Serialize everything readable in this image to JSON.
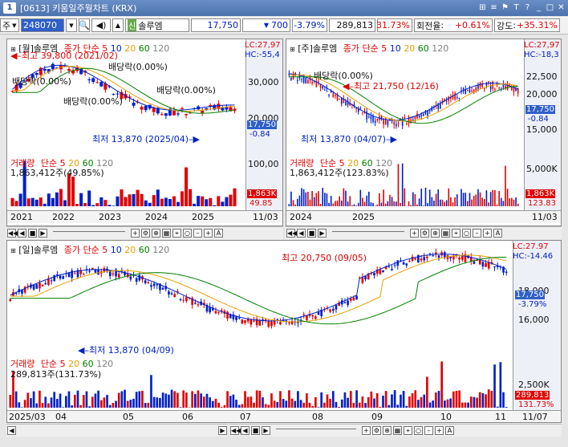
{
  "window": {
    "num": "1",
    "title": "[0613] 키움일주월차트 (KRX)"
  },
  "toolbar": {
    "type": "주",
    "code": "248070",
    "badge": "신",
    "name": "솔루엠",
    "price": "17,750",
    "change": "700",
    "change_pct": "-3.79%",
    "volume": "289,813",
    "volume_pct": "31.73%",
    "turnover_label": "회전율",
    "turnover": "+0.61%",
    "strength_label": "강도",
    "strength": "+35.31%"
  },
  "monthly": {
    "title": "[월]솔루엠",
    "ma_label": "종가 단순",
    "ma": [
      "5",
      "10",
      "20",
      "60",
      "120"
    ],
    "lc": "LC:27,97",
    "hc": "HC:-55,4",
    "high_label": "최고 39,800 (2021/02)",
    "low_label": "최저 13,870 (2025/04)",
    "div1": "배당락(0.00%)",
    "div2": "배당락(0.00%)",
    "div3": "배당락(0.00%)",
    "div4": "배당락(0.00%)",
    "y_ticks": [
      "30,000",
      "20,000"
    ],
    "price_hl": "17,750",
    "price_pct": "-0.84",
    "vol_title": "거래량",
    "vol_ma_label": "단순",
    "vol_ma": [
      "5",
      "20",
      "60",
      "120"
    ],
    "vol_value": "1,863,412주(49.85%)",
    "vol_tick": "100,00",
    "vol_hl": "1,863K",
    "vol_pct": "49.85",
    "x_ticks": [
      "2021",
      "2022",
      "2023",
      "2024",
      "2025"
    ],
    "date": "11/03"
  },
  "weekly": {
    "title": "[주]솔루엠",
    "ma_label": "종가 단순",
    "ma": [
      "5",
      "10",
      "20",
      "60",
      "120"
    ],
    "lc": "LC:27,97",
    "hc": "HC:-18,3",
    "high_label": "최고 21,750 (12/16)",
    "low_label": "최저 13,870 (04/07)",
    "div": "배당락(0.00%)",
    "y_ticks": [
      "22,500",
      "20,000",
      "17,500",
      "15,000"
    ],
    "price_hl": "17,750",
    "price_pct": "-0.84",
    "vol_title": "거래량",
    "vol_ma_label": "단순",
    "vol_ma": [
      "5",
      "20",
      "60",
      "120"
    ],
    "vol_value": "1,863,412주(123.83%)",
    "vol_tick": "5,000K",
    "vol_hl": "1,863K",
    "vol_pct": "123.83",
    "x_ticks": [
      "2024",
      "2025"
    ],
    "date": "11/03"
  },
  "daily": {
    "title": "[일]솔루엠",
    "ma_label": "종가 단순",
    "ma": [
      "5",
      "10",
      "20",
      "60",
      "120"
    ],
    "lc": "LC:27.97",
    "hc": "HC:-14.46",
    "high_label": "최고 20,750 (09/05)",
    "low_label": "최저 13,870 (04/09)",
    "y_ticks": [
      "18,000",
      "16,000"
    ],
    "price_hl": "17,750",
    "price_pct": "-3.79%",
    "vol_title": "거래량",
    "vol_ma_label": "단순",
    "vol_ma": [
      "5",
      "20",
      "60",
      "120"
    ],
    "vol_value": "289,813주(131.73%)",
    "vol_tick": "2,500K",
    "vol_hl": "289,813",
    "vol_pct": "131.73%",
    "x_ticks": [
      "2025/03",
      "04",
      "05",
      "06",
      "07",
      "08",
      "09",
      "10",
      "11"
    ],
    "date": "11/07"
  },
  "colors": {
    "up": "#e00000",
    "down": "#0020c8",
    "ma5": "#e00000",
    "ma10": "#0020c8",
    "ma20": "#e8a000",
    "ma60": "#008000",
    "ma120": "#808080",
    "highlight": "#2f5fc9"
  }
}
